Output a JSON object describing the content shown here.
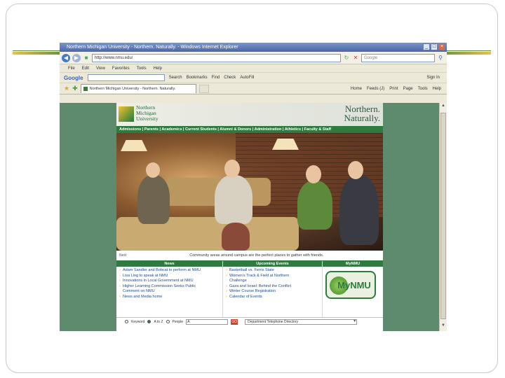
{
  "browser": {
    "title": "Northern Michigan University - Northern. Naturally. - Windows Internet Explorer",
    "url": "http://www.nmu.edu/",
    "search_placeholder": "Google",
    "menu": [
      "File",
      "Edit",
      "View",
      "Favorites",
      "Tools",
      "Help"
    ],
    "google_toolbar": {
      "logo": "Google",
      "items": [
        "Search",
        "Bookmarks",
        "Find",
        "Check",
        "AutoFill",
        "Sign In"
      ]
    },
    "tab_label": "Northern Michigan University - Northern. Naturally.",
    "command_bar": [
      "Home",
      "Feeds (J)",
      "Print",
      "Page",
      "Tools",
      "Help"
    ]
  },
  "site": {
    "logo_lines": [
      "Northern",
      "Michigan",
      "University"
    ],
    "tagline_lines": [
      "Northern.",
      "Naturally."
    ],
    "nav": "Admissions | Parents | Academics | Current Students | Alumni & Donors | Administration | Athletics | Faculty & Staff",
    "photo_next": "Next",
    "photo_caption": "Community areas around campus are the perfect places to gather with friends.",
    "news": {
      "header": "News",
      "items": [
        "Adam Sandler and Bobcat to perform at NMU",
        "Lisa Ling to speak at NMU",
        "Innovations in Local Government at NMU",
        "Higher Learning Commission Seeks Public",
        "Comment on NMU",
        "News and Media home"
      ]
    },
    "events": {
      "header": "Upcoming Events",
      "items": [
        "Basketball vs. Ferris State",
        "Women's Track & Field at Northern",
        "Challenge",
        "Gaza and Israel: Behind the Conflict",
        "Winter Course Registration",
        "Calendar of Events"
      ]
    },
    "mynmu": {
      "header": "MyNMU",
      "logo_text": "MyNMU"
    },
    "search": {
      "options": [
        "Keyword",
        "A to Z",
        "People"
      ],
      "field_value": "A",
      "go_label": "GO",
      "directory": "Department Telephone Directory"
    }
  }
}
